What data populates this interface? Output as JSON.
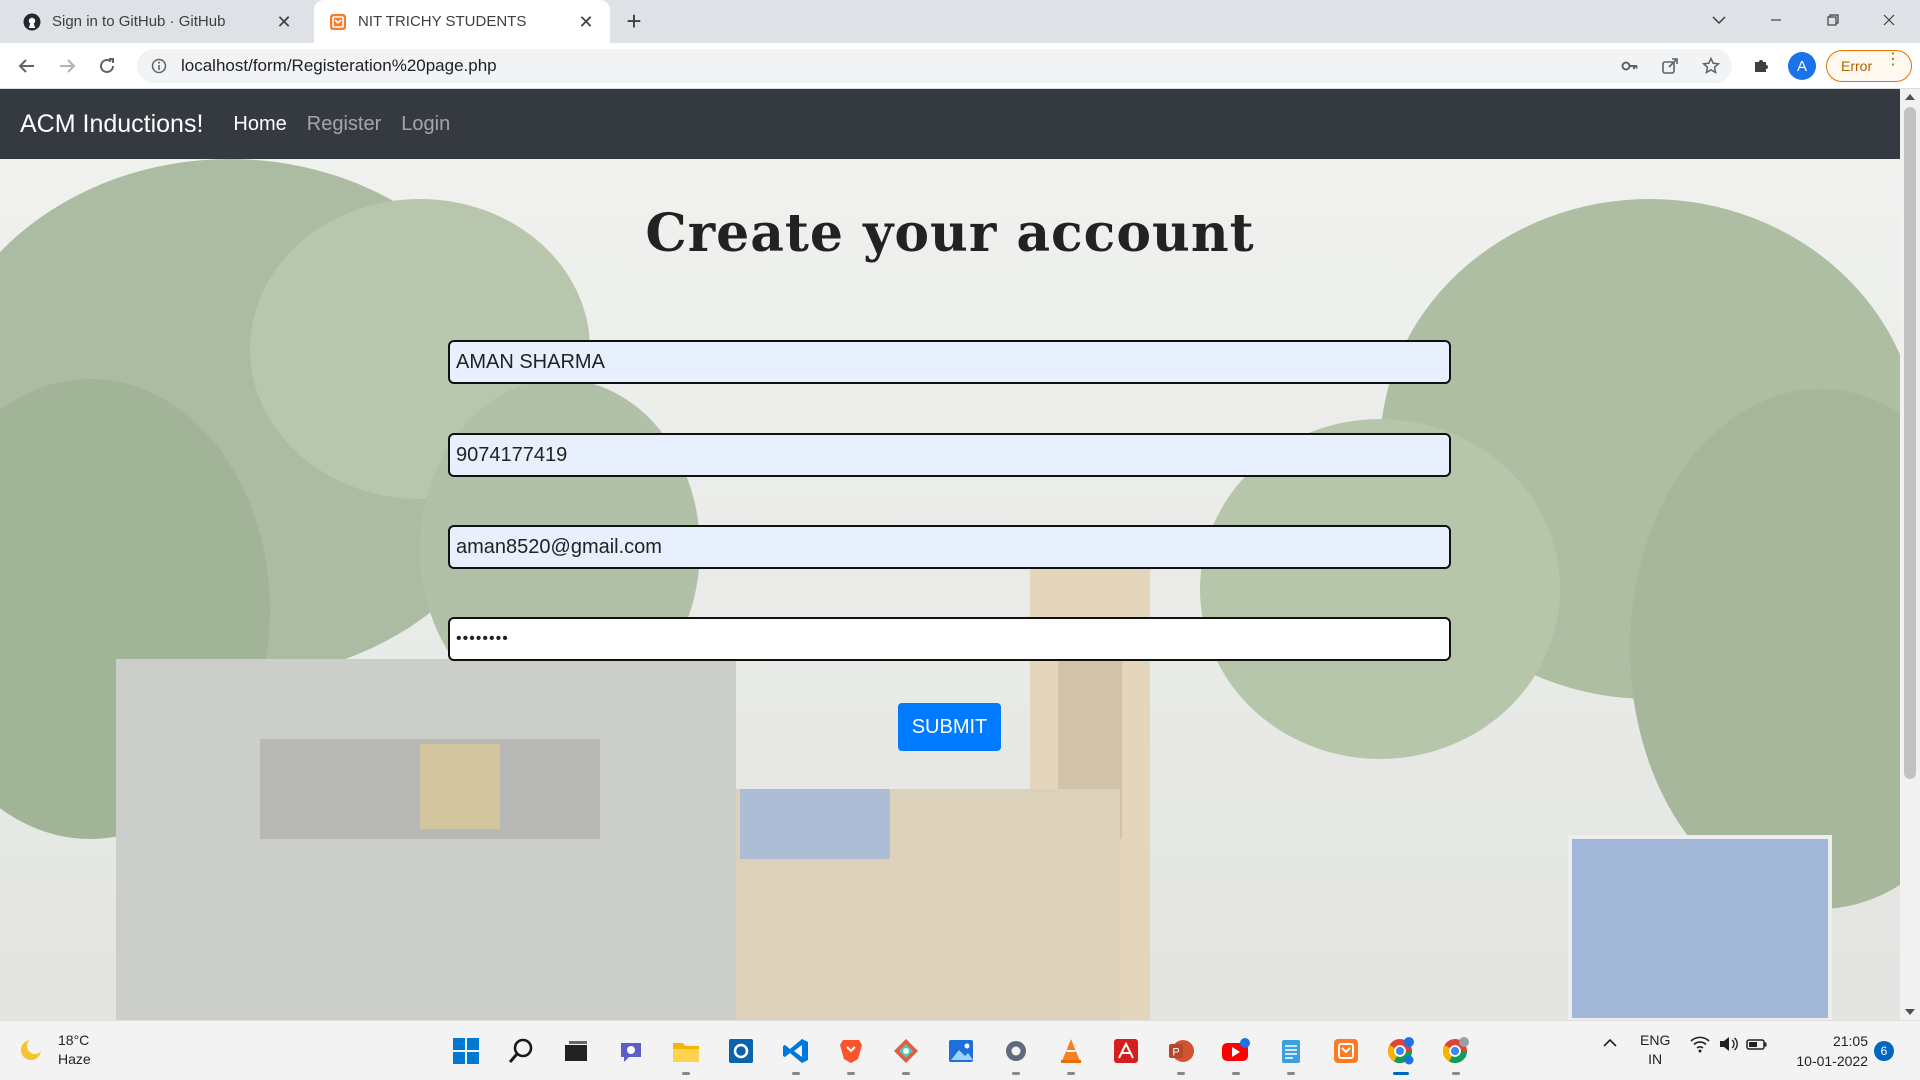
{
  "browser": {
    "tabs": [
      {
        "title": "Sign in to GitHub · GitHub",
        "favicon": "github-icon",
        "active": false
      },
      {
        "title": "NIT TRICHY STUDENTS",
        "favicon": "html5-icon",
        "active": true
      }
    ],
    "url": "localhost/form/Registeration%20page.php",
    "profile_initial": "A",
    "error_label": "Error"
  },
  "site": {
    "brand": "ACM Inductions!",
    "nav": [
      {
        "label": "Home",
        "active": true
      },
      {
        "label": "Register",
        "active": false
      },
      {
        "label": "Login",
        "active": false
      }
    ]
  },
  "form": {
    "heading": "Create your account",
    "name_value": "AMAN SHARMA",
    "phone_value": "9074177419",
    "email_value": "aman8520@gmail.com",
    "password_value": "••••••••",
    "submit_label": "SUBMIT"
  },
  "taskbar": {
    "weather_temp": "18°C",
    "weather_desc": "Haze",
    "apps": [
      "windows-start-icon",
      "search-icon",
      "task-view-icon",
      "teams-chat-icon",
      "file-explorer-icon",
      "outlook-icon",
      "vscode-icon",
      "brave-icon",
      "gitkraken-icon",
      "photos-icon",
      "settings-icon",
      "vlc-icon",
      "acrobat-icon",
      "powerpoint-icon",
      "youtube-icon",
      "notepad-icon",
      "xampp-icon",
      "chrome-icon",
      "chrome-profile-icon"
    ],
    "lang_top": "ENG",
    "lang_bottom": "IN",
    "time": "21:05",
    "date": "10-01-2022",
    "notification_count": "6"
  },
  "colors": {
    "navbar_bg": "#343a40",
    "submit_bg": "#007bff",
    "autofill_bg": "#e8f0fe"
  }
}
